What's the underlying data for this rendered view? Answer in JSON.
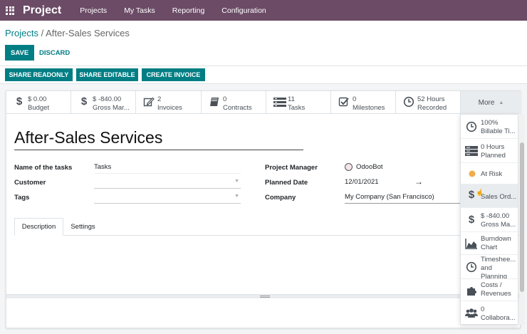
{
  "app": {
    "name": "Project",
    "menu": [
      "Projects",
      "My Tasks",
      "Reporting",
      "Configuration"
    ]
  },
  "breadcrumb": {
    "parent": "Projects",
    "separator": " / ",
    "current": "After-Sales Services"
  },
  "buttons": {
    "save": "SAVE",
    "discard": "DISCARD",
    "share_readonly": "SHARE READONLY",
    "share_editable": "SHARE EDITABLE",
    "create_invoice": "CREATE INVOICE"
  },
  "stat_buttons": [
    {
      "icon": "dollar-icon",
      "value": "$ 0.00",
      "label": "Budget"
    },
    {
      "icon": "dollar-icon",
      "value": "$ -840.00",
      "label": "Gross Mar..."
    },
    {
      "icon": "pencil-square-icon",
      "value": "2",
      "label": "Invoices"
    },
    {
      "icon": "book-icon",
      "value": "0",
      "label": "Contracts"
    },
    {
      "icon": "tasks-icon",
      "value": "11",
      "label": "Tasks"
    },
    {
      "icon": "check-square-icon",
      "value": "0",
      "label": "Milestones"
    },
    {
      "icon": "clock-icon",
      "value": "52 Hours",
      "label": "Recorded"
    }
  ],
  "more_label": "More",
  "project": {
    "title": "After-Sales Services",
    "fields": {
      "name_of_tasks": {
        "label": "Name of the tasks",
        "value": "Tasks"
      },
      "customer": {
        "label": "Customer",
        "value": ""
      },
      "tags": {
        "label": "Tags",
        "value": ""
      },
      "project_manager": {
        "label": "Project Manager",
        "value": "OdooBot"
      },
      "planned_date": {
        "label": "Planned Date",
        "value": "12/01/2021",
        "arrow": "→"
      },
      "company": {
        "label": "Company",
        "value": "My Company (San Francisco)"
      }
    }
  },
  "tabs": [
    "Description",
    "Settings"
  ],
  "dropdown_items": [
    {
      "icon": "clock-icon",
      "line1": "100%",
      "line2": "Billable Ti..."
    },
    {
      "icon": "server-icon",
      "line1": "0 Hours",
      "line2": "Planned"
    },
    {
      "icon": "status-dot-icon",
      "line1": "At Risk"
    },
    {
      "icon": "dollar-icon",
      "line1": "Sales Ord..."
    },
    {
      "icon": "dollar-icon",
      "line1": "$ -840.00",
      "line2": "Gross Ma..."
    },
    {
      "icon": "area-chart-icon",
      "line1": "Burndown",
      "line2": "Chart"
    },
    {
      "icon": "clock-icon",
      "line1": "Timeshee...",
      "line2": "and",
      "line3": "Planning"
    },
    {
      "icon": "puzzle-icon",
      "line1": "Costs /",
      "line2": "Revenues"
    },
    {
      "icon": "users-icon",
      "line1": "0",
      "line2": "Collabora..."
    }
  ],
  "colors": {
    "brand": "#6b4b66",
    "primary": "#017e84",
    "at_risk_dot": "#f0ad4e"
  }
}
